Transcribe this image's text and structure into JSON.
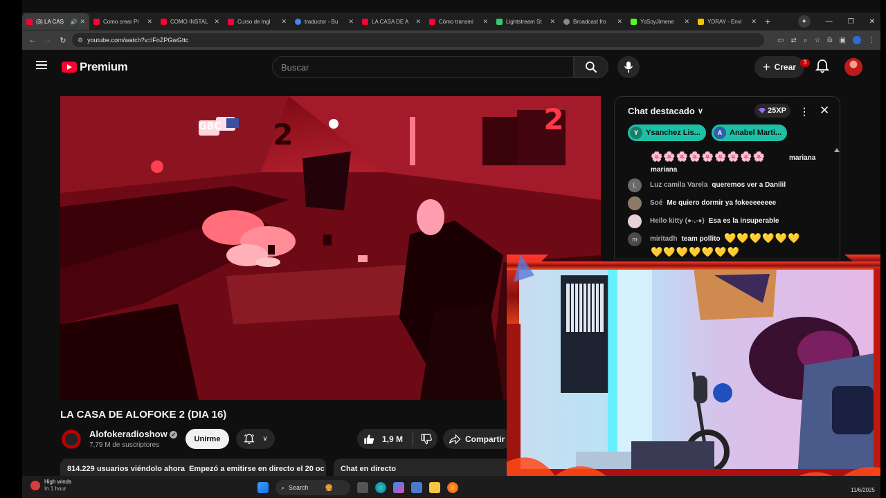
{
  "browser": {
    "tabs": [
      {
        "label": "(3) LA CAS",
        "color": "#ff0033"
      },
      {
        "label": "Como crear Pl",
        "color": "#ff0033"
      },
      {
        "label": "COMO INSTAL",
        "color": "#ff0033"
      },
      {
        "label": "Curso de Ingl",
        "color": "#ff0033"
      },
      {
        "label": "traductor - Bu",
        "color": "#4285f4"
      },
      {
        "label": "LA CASA DE A",
        "color": "#ff0033"
      },
      {
        "label": "Cómo transmi",
        "color": "#ff0033"
      },
      {
        "label": "Lightstream St",
        "color": "#2ecc71"
      },
      {
        "label": "Broadcast fro",
        "color": "#888888"
      },
      {
        "label": "YoSoyJimene",
        "color": "#53fc18"
      },
      {
        "label": "YDRAY - Envi",
        "color": "#f5c400"
      }
    ],
    "url": "youtube.com/watch?v=lFnZPGwGttc"
  },
  "yt": {
    "logo_text": "Premium",
    "search_placeholder": "Buscar",
    "create_label": "Crear",
    "notif_count": "3"
  },
  "video": {
    "title": "LA CASA DE ALOFOKE 2 (DIA 16)",
    "channel": "Alofokeradioshow",
    "subscribers": "7,79 M de suscriptores",
    "join_label": "Unirme",
    "likes": "1,9 M",
    "share_label": "Compartir",
    "viewers": "814.229 usuarios viéndolo ahora",
    "started": "Empezó a emitirse en directo el 20 oc",
    "live_chat_label": "Chat en directo",
    "overlay_number": "2",
    "sign_text": "GBC"
  },
  "chat": {
    "header": "Chat destacado",
    "xp": "25XP",
    "pinned": [
      {
        "initial": "Y",
        "name": "Ysanchez Lis...",
        "color": "#1a7f6a"
      },
      {
        "initial": "A",
        "name": "Anabel Marti...",
        "color": "#2f5fb0"
      }
    ],
    "top_user_fragment": "mariana",
    "top_user_line2": "mariana",
    "top_emojis": "🌸🌸🌸🌸🌸🌸🌸🌸🌸",
    "messages": [
      {
        "initial": "L",
        "author": "Luz camila Varela",
        "text": "queremos ver a Danilil",
        "color": "#6a6a6a"
      },
      {
        "initial": "",
        "author": "Soé",
        "text": "Me quiero dormir ya fokeeeeeeee",
        "color": "#8a7a66"
      },
      {
        "initial": "",
        "author": "Hello kitty (●-.-●)",
        "text": "Esa es la insuperable",
        "color": "#e8d0d8"
      },
      {
        "initial": "m",
        "author": "miritadh",
        "text": "team pollito",
        "color": "#4a4a4a"
      }
    ],
    "heart_row1": "💛💛💛💛💛💛",
    "heart_row2": "💛💛💛💛💛💛💛"
  },
  "taskbar": {
    "weather_title": "High winds",
    "weather_sub": "In 1 hour",
    "search_label": "Search",
    "date": "11/6/2025"
  }
}
